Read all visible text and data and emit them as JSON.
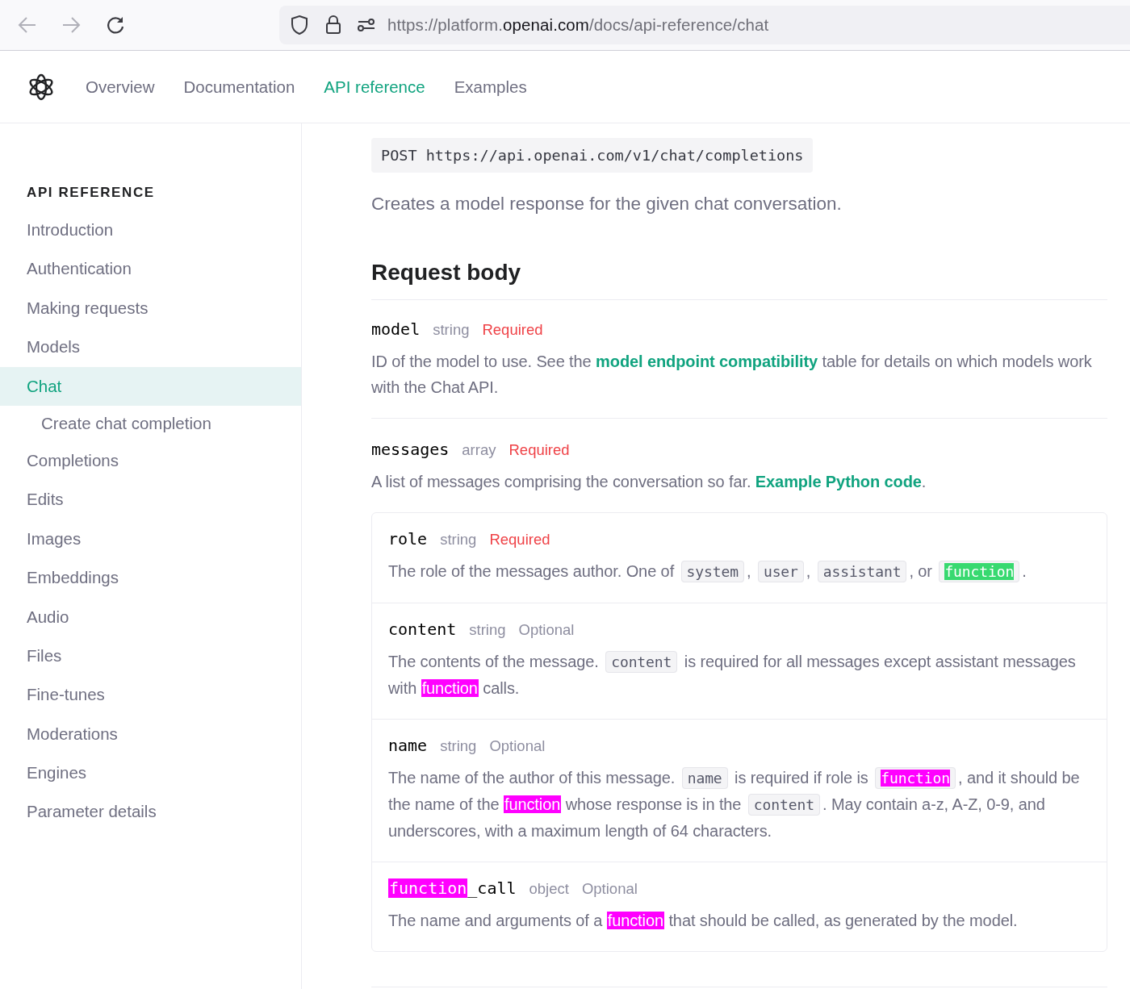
{
  "browser": {
    "url_prefix": "https://platform.",
    "url_host": "openai.com",
    "url_path": "/docs/api-reference/chat"
  },
  "top_nav": {
    "items": [
      {
        "label": "Overview",
        "selected": false
      },
      {
        "label": "Documentation",
        "selected": false
      },
      {
        "label": "API reference",
        "selected": true
      },
      {
        "label": "Examples",
        "selected": false
      }
    ]
  },
  "sidebar": {
    "heading": "API REFERENCE",
    "items": [
      {
        "label": "Introduction",
        "selected": false
      },
      {
        "label": "Authentication",
        "selected": false
      },
      {
        "label": "Making requests",
        "selected": false
      },
      {
        "label": "Models",
        "selected": false
      },
      {
        "label": "Chat",
        "selected": true,
        "children": [
          {
            "label": "Create chat completion",
            "selected": false
          }
        ]
      },
      {
        "label": "Completions",
        "selected": false
      },
      {
        "label": "Edits",
        "selected": false
      },
      {
        "label": "Images",
        "selected": false
      },
      {
        "label": "Embeddings",
        "selected": false
      },
      {
        "label": "Audio",
        "selected": false
      },
      {
        "label": "Files",
        "selected": false
      },
      {
        "label": "Fine-tunes",
        "selected": false
      },
      {
        "label": "Moderations",
        "selected": false
      },
      {
        "label": "Engines",
        "selected": false
      },
      {
        "label": "Parameter details",
        "selected": false
      }
    ]
  },
  "endpoint": "POST https://api.openai.com/v1/chat/completions",
  "summary": "Creates a model response for the given chat conversation.",
  "request_body": {
    "title": "Request body",
    "params": [
      {
        "name": [
          {
            "kind": "text",
            "text": "model"
          }
        ],
        "type": "string",
        "requirement": "Required",
        "required": true,
        "description": [
          {
            "kind": "text",
            "text": "ID of the model to use. See the "
          },
          {
            "kind": "link",
            "text": "model endpoint compatibility"
          },
          {
            "kind": "text",
            "text": " table for details on which models work with the Chat API."
          }
        ]
      },
      {
        "name": [
          {
            "kind": "text",
            "text": "messages"
          }
        ],
        "type": "array",
        "requirement": "Required",
        "required": true,
        "description": [
          {
            "kind": "text",
            "text": "A list of messages comprising the conversation so far. "
          },
          {
            "kind": "link",
            "text": "Example Python code"
          },
          {
            "kind": "text",
            "text": "."
          }
        ],
        "children": [
          {
            "name": [
              {
                "kind": "text",
                "text": "role"
              }
            ],
            "type": "string",
            "requirement": "Required",
            "required": true,
            "description": [
              {
                "kind": "text",
                "text": "The role of the messages author. One of "
              },
              {
                "kind": "code",
                "text": "system"
              },
              {
                "kind": "text",
                "text": ", "
              },
              {
                "kind": "code",
                "text": "user"
              },
              {
                "kind": "text",
                "text": ", "
              },
              {
                "kind": "code",
                "text": "assistant"
              },
              {
                "kind": "text",
                "text": ", or "
              },
              {
                "kind": "code-current",
                "text": "function"
              },
              {
                "kind": "text",
                "text": "."
              }
            ]
          },
          {
            "name": [
              {
                "kind": "text",
                "text": "content"
              }
            ],
            "type": "string",
            "requirement": "Optional",
            "required": false,
            "description": [
              {
                "kind": "text",
                "text": "The contents of the message. "
              },
              {
                "kind": "code",
                "text": "content"
              },
              {
                "kind": "text",
                "text": " is required for all messages except assistant messages with "
              },
              {
                "kind": "hit",
                "text": "function"
              },
              {
                "kind": "text",
                "text": " calls."
              }
            ]
          },
          {
            "name": [
              {
                "kind": "text",
                "text": "name"
              }
            ],
            "type": "string",
            "requirement": "Optional",
            "required": false,
            "description": [
              {
                "kind": "text",
                "text": "The name of the author of this message. "
              },
              {
                "kind": "code",
                "text": "name"
              },
              {
                "kind": "text",
                "text": " is required if role is "
              },
              {
                "kind": "code-hit",
                "text": "function"
              },
              {
                "kind": "text",
                "text": ", and it should be the name of the "
              },
              {
                "kind": "hit",
                "text": "function"
              },
              {
                "kind": "text",
                "text": " whose response is in the "
              },
              {
                "kind": "code",
                "text": "content"
              },
              {
                "kind": "text",
                "text": ". May contain a-z, A-Z, 0-9, and underscores, with a maximum length of 64 characters."
              }
            ]
          },
          {
            "name": [
              {
                "kind": "hit",
                "text": "function"
              },
              {
                "kind": "text",
                "text": "_call"
              }
            ],
            "type": "object",
            "requirement": "Optional",
            "required": false,
            "description": [
              {
                "kind": "text",
                "text": "The name and arguments of a "
              },
              {
                "kind": "hit",
                "text": "function"
              },
              {
                "kind": "text",
                "text": " that should be called, as generated by the model."
              }
            ]
          }
        ]
      }
    ]
  }
}
